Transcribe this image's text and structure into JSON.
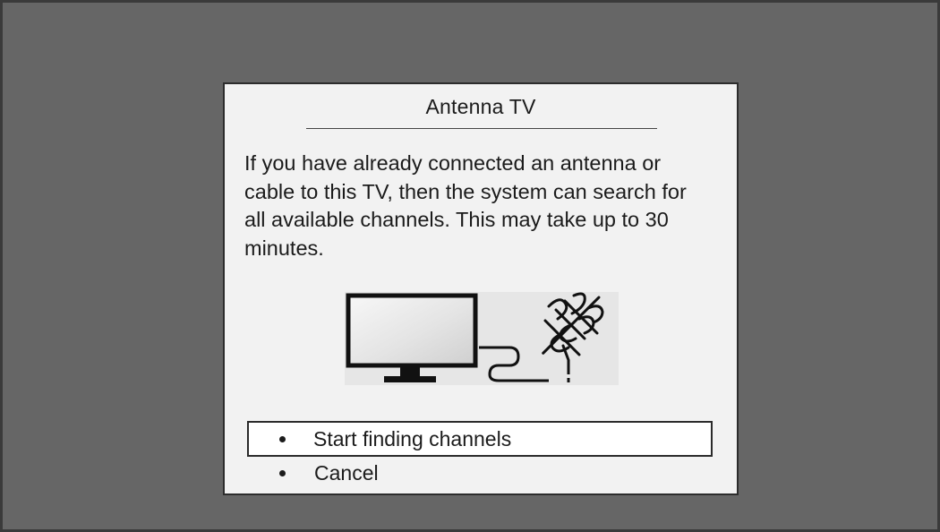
{
  "dialog": {
    "title": "Antenna TV",
    "message": "If you have already connected an antenna or cable to this TV, then the system can search for all available channels. This may take up to 30 minutes."
  },
  "illustration": {
    "icons": [
      "tv-icon",
      "antenna-icon"
    ]
  },
  "menu": {
    "items": [
      {
        "label": "Start finding channels",
        "selected": true
      },
      {
        "label": "Cancel",
        "selected": false
      }
    ]
  },
  "colors": {
    "background": "#666666",
    "dialog": "#f2f2f2",
    "selected_item": "#ffffff",
    "text": "#1b1b1b"
  }
}
